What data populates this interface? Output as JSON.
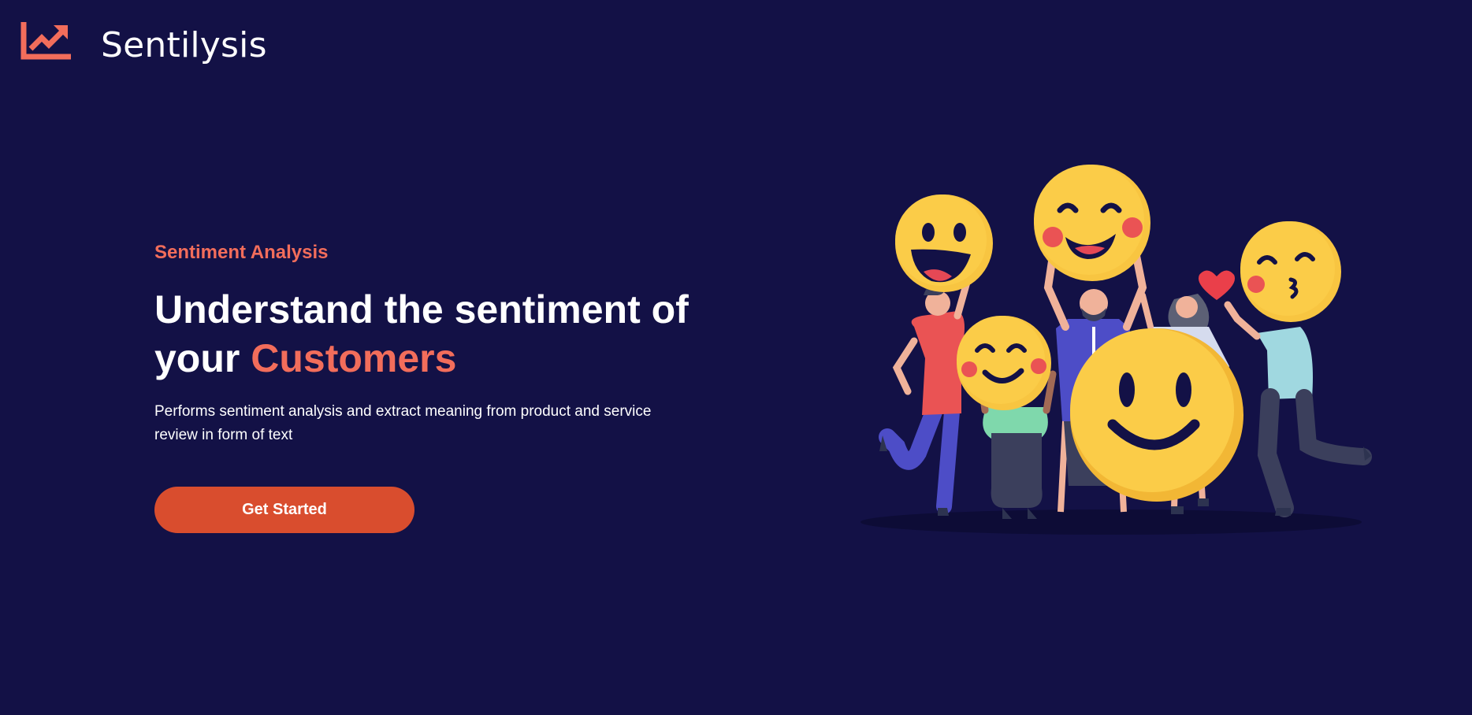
{
  "header": {
    "logo_icon": "trending-up-chart-icon",
    "brand_name": "Sentilysis"
  },
  "hero": {
    "eyebrow": "Sentiment Analysis",
    "headline_part1": "Understand the sentiment of your ",
    "headline_accent": "Customers",
    "description": "Performs sentiment analysis and extract meaning from product and service review in form of text",
    "cta_label": "Get Started"
  },
  "illustration": {
    "name": "people-holding-emoji-faces-illustration"
  },
  "colors": {
    "background": "#131146",
    "accent": "#f26d5b",
    "button": "#d94d2e",
    "emoji_yellow": "#f8c541"
  }
}
